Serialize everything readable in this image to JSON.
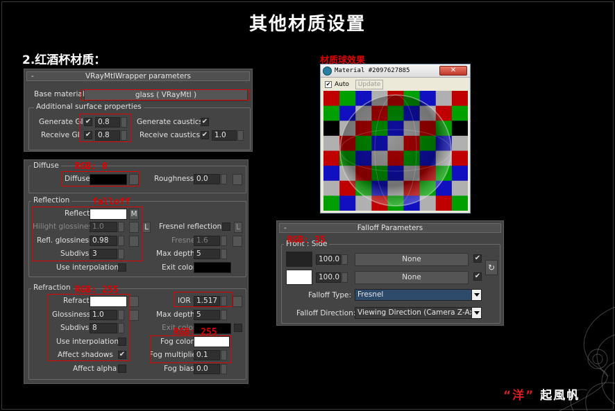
{
  "page": {
    "title": "其他材质设置",
    "subtitle": "2.红酒杯材质：",
    "preview_caption": "材质球效果",
    "signature_prefix": "“洋”",
    "signature_suffix": " 起風帆"
  },
  "wrapper": {
    "header": "VRayMtlWrapper parameters",
    "base_material_label": "Base material:",
    "base_material_value": "glass  ( VRayMtl )",
    "group_label": "Additional surface properties",
    "generate_gi_label": "Generate GI",
    "generate_gi_value": "0.8",
    "receive_gi_label": "Receive GI",
    "receive_gi_value": "0.8",
    "generate_caustics_label": "Generate caustics",
    "receive_caustics_label": "Receive caustics",
    "receive_caustics_value": "1.0"
  },
  "vraymtl": {
    "diffuse_group": "Diffuse",
    "diffuse_label": "Diffuse",
    "diffuse_note": "RGB: 0",
    "roughness_label": "Roughness",
    "roughness_value": "0.0",
    "reflection_group": "Reflection",
    "reflect_label": "Reflect",
    "reflect_note": "falloff",
    "map_button": "M",
    "hilight_label": "Hilight glossiness",
    "hilight_value": "1.0",
    "lock_button": "L",
    "refl_gloss_label": "Refl. glossiness",
    "refl_gloss_value": "0.98",
    "subdivs_label": "Subdivs",
    "refl_subdivs_value": "3",
    "use_interp_label": "Use interpolation",
    "fresnel_label": "Fresnel reflections",
    "fresnel_ior_label": "Fresnel IOR",
    "fresnel_ior_value": "1.6",
    "max_depth_label": "Max depth",
    "refl_max_depth_value": "5",
    "exit_color_label": "Exit color",
    "refraction_group": "Refraction",
    "refract_label": "Refract",
    "refract_note": "RGB: 255",
    "ior_label": "IOR",
    "ior_value": "1.517",
    "glossiness_label": "Glossiness",
    "refr_gloss_value": "1.0",
    "refr_max_depth_value": "5",
    "refr_subdivs_value": "8",
    "fog_color_label": "Fog color",
    "fog_note": "RGB: 255",
    "affect_shadows_label": "Affect shadows",
    "fog_mult_label": "Fog multiplier",
    "fog_mult_value": "0.1",
    "affect_alpha_label": "Affect alpha",
    "fog_bias_label": "Fog bias",
    "fog_bias_value": "0.0"
  },
  "material_window": {
    "title": "Material #2097627885",
    "close": "✕",
    "auto_label": "Auto",
    "update_label": "Update"
  },
  "falloff": {
    "header": "Falloff Parameters",
    "front_side_label": "Front : Side",
    "note": "RGB: 35",
    "amount1": "100.0",
    "amount2": "100.0",
    "map1": "None",
    "map2": "None",
    "type_label": "Falloff Type:",
    "type_value": "Fresnel",
    "direction_label": "Falloff Direction:",
    "direction_value": "Viewing Direction (Camera Z-Axis)"
  },
  "colors": {
    "diffuse": "#000000",
    "reflect": "#ffffff",
    "refract": "#ffffff",
    "fog": "#ffffff",
    "falloff_front": "#232323",
    "falloff_side": "#ffffff",
    "annotation": "#e00000",
    "checker": [
      "#c00000",
      "#00a000",
      "#1010c0",
      "#b0b0b0",
      "#000000"
    ]
  }
}
